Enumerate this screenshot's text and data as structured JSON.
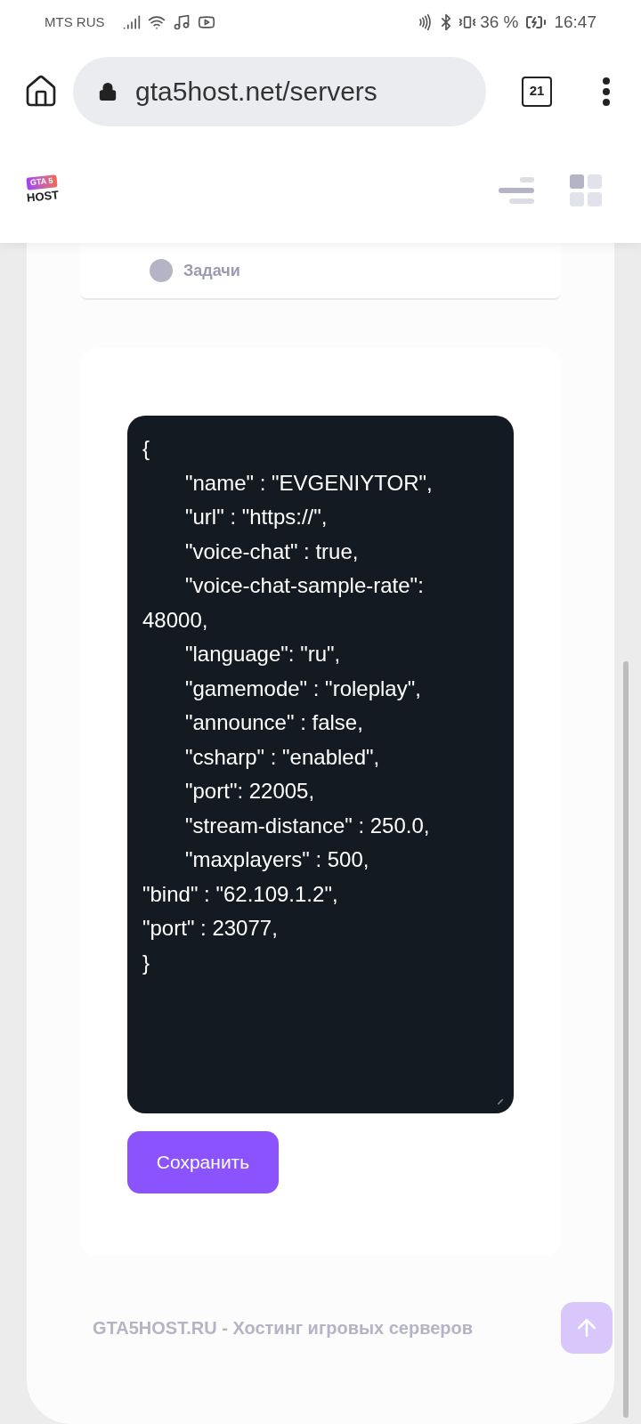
{
  "status_bar": {
    "carrier": "MTS RUS",
    "battery": "36 %",
    "time": "16:47"
  },
  "browser": {
    "url": "gta5host.net/servers",
    "tab_count": "21"
  },
  "site_header": {
    "logo_top": "GTA 5",
    "logo_bottom": "HOST"
  },
  "menu_item": {
    "label": "Задачи"
  },
  "config_editor": {
    "lines": [
      {
        "text": "{",
        "indent": false
      },
      {
        "text": "\"name\" : \"EVGENIYTOR\",",
        "indent": true
      },
      {
        "text": "\"url\" : \"https://\",",
        "indent": true
      },
      {
        "text": "\"voice-chat\" : true,",
        "indent": true
      },
      {
        "text": "\"voice-chat-sample-rate\": 48000,",
        "indent": true
      },
      {
        "text": "\"language\": \"ru\",",
        "indent": true
      },
      {
        "text": "\"gamemode\" : \"roleplay\",",
        "indent": true
      },
      {
        "text": "\"announce\" : false,",
        "indent": true
      },
      {
        "text": "\"csharp\" : \"enabled\",",
        "indent": true
      },
      {
        "text": "\"port\": 22005,",
        "indent": true
      },
      {
        "text": "\"stream-distance\" : 250.0,",
        "indent": true
      },
      {
        "text": "\"maxplayers\" : 500,",
        "indent": true
      },
      {
        "text": "\"bind\" : \"62.109.1.2\",",
        "indent": false
      },
      {
        "text": "\"port\" : 23077,",
        "indent": false
      },
      {
        "text": "}",
        "indent": false
      }
    ],
    "save_button": "Сохранить"
  },
  "footer": {
    "text": "GTA5HOST.RU - Хостинг игровых серверов"
  }
}
